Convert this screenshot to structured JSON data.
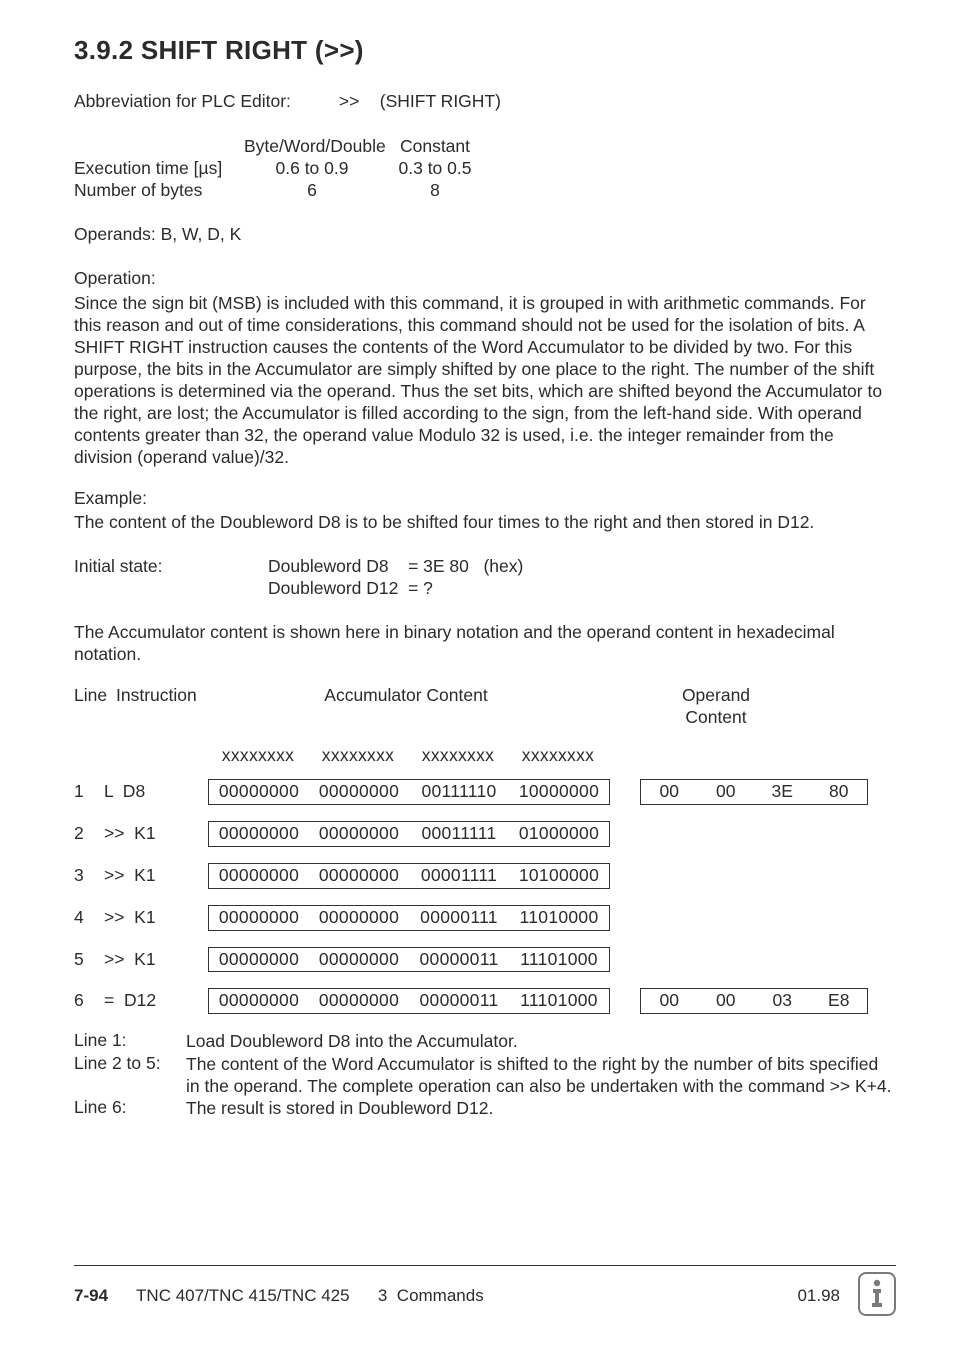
{
  "heading": "3.9.2  SHIFT RIGHT   (>>)",
  "abbrev": {
    "label": "Abbreviation for PLC Editor:",
    "symbol": ">>",
    "name": "(SHIFT RIGHT)"
  },
  "specs": {
    "header": {
      "c2": "Byte/Word/Double",
      "c3": "Constant"
    },
    "rows": [
      {
        "c1": "Execution time [µs]",
        "c2": "0.6 to 0.9",
        "c3": "0.3 to 0.5"
      },
      {
        "c1": "Number of bytes",
        "c2": "6",
        "c3": "8"
      }
    ]
  },
  "operands": "Operands: B, W, D, K",
  "operation": {
    "label": "Operation:",
    "text": "Since the sign bit (MSB) is included with this command, it is grouped in with arithmetic commands. For this reason and out of time considerations, this command should not be used for the isolation of bits. A SHIFT RIGHT instruction causes the contents of the Word Accumulator to be divided by two. For this purpose, the bits in the Accumulator are simply shifted by one place to the right. The number of the shift operations is determined via the operand. Thus the set bits, which are shifted beyond the Accumulator to the right, are lost; the Accumulator is filled according to the sign, from the left-hand side. With operand contents greater than 32, the operand value Modulo 32 is used, i.e. the integer remainder from the division (operand value)/32."
  },
  "example": {
    "label": "Example:",
    "text": "The content of the Doubleword D8 is to be shifted four times to the right and then stored in D12."
  },
  "initial": {
    "lead": "Initial state:",
    "line1": "Doubleword D8    = 3E 80   (hex)",
    "line2": "Doubleword D12  = ?"
  },
  "accu_note": "The Accumulator content is shown here in binary notation and the operand content in hexadecimal notation.",
  "tbl": {
    "headers": {
      "line": "Line",
      "instr": "Instruction",
      "accu": "Accumulator Content",
      "ops": "Operand\nContent"
    },
    "accu_header_cells": [
      "xxxxxxxx",
      "xxxxxxxx",
      "xxxxxxxx",
      "xxxxxxxx"
    ],
    "rows": [
      {
        "n": "1",
        "instr": "L  D8",
        "accu": [
          "00000000",
          "00000000",
          "00111110",
          "10000000"
        ],
        "ops": [
          "00",
          "00",
          "3E",
          "80"
        ]
      },
      {
        "n": "2",
        "instr": ">>  K1",
        "accu": [
          "00000000",
          "00000000",
          "00011111",
          "01000000"
        ],
        "ops": null
      },
      {
        "n": "3",
        "instr": ">>  K1",
        "accu": [
          "00000000",
          "00000000",
          "00001111",
          "10100000"
        ],
        "ops": null
      },
      {
        "n": "4",
        "instr": ">>  K1",
        "accu": [
          "00000000",
          "00000000",
          "00000111",
          "11010000"
        ],
        "ops": null
      },
      {
        "n": "5",
        "instr": ">>  K1",
        "accu": [
          "00000000",
          "00000000",
          "00000011",
          "11101000"
        ],
        "ops": null
      },
      {
        "n": "6",
        "instr": "=  D12",
        "accu": [
          "00000000",
          "00000000",
          "00000011",
          "11101000"
        ],
        "ops": [
          "00",
          "00",
          "03",
          "E8"
        ]
      }
    ]
  },
  "line_notes": [
    {
      "label": "Line 1:",
      "text": "Load Doubleword D8 into the Accumulator."
    },
    {
      "label": "Line 2 to 5:",
      "text": "The content of the Word  Accumulator is shifted to the right by the number of bits specified in the operand. The complete operation can also be undertaken with the command >> K+4."
    },
    {
      "label": "Line 6:",
      "text": "The result is stored in Doubleword D12."
    }
  ],
  "footer": {
    "page": "7-94",
    "mid": "TNC 407/TNC 415/TNC 425      3  Commands",
    "date": "01.98"
  }
}
